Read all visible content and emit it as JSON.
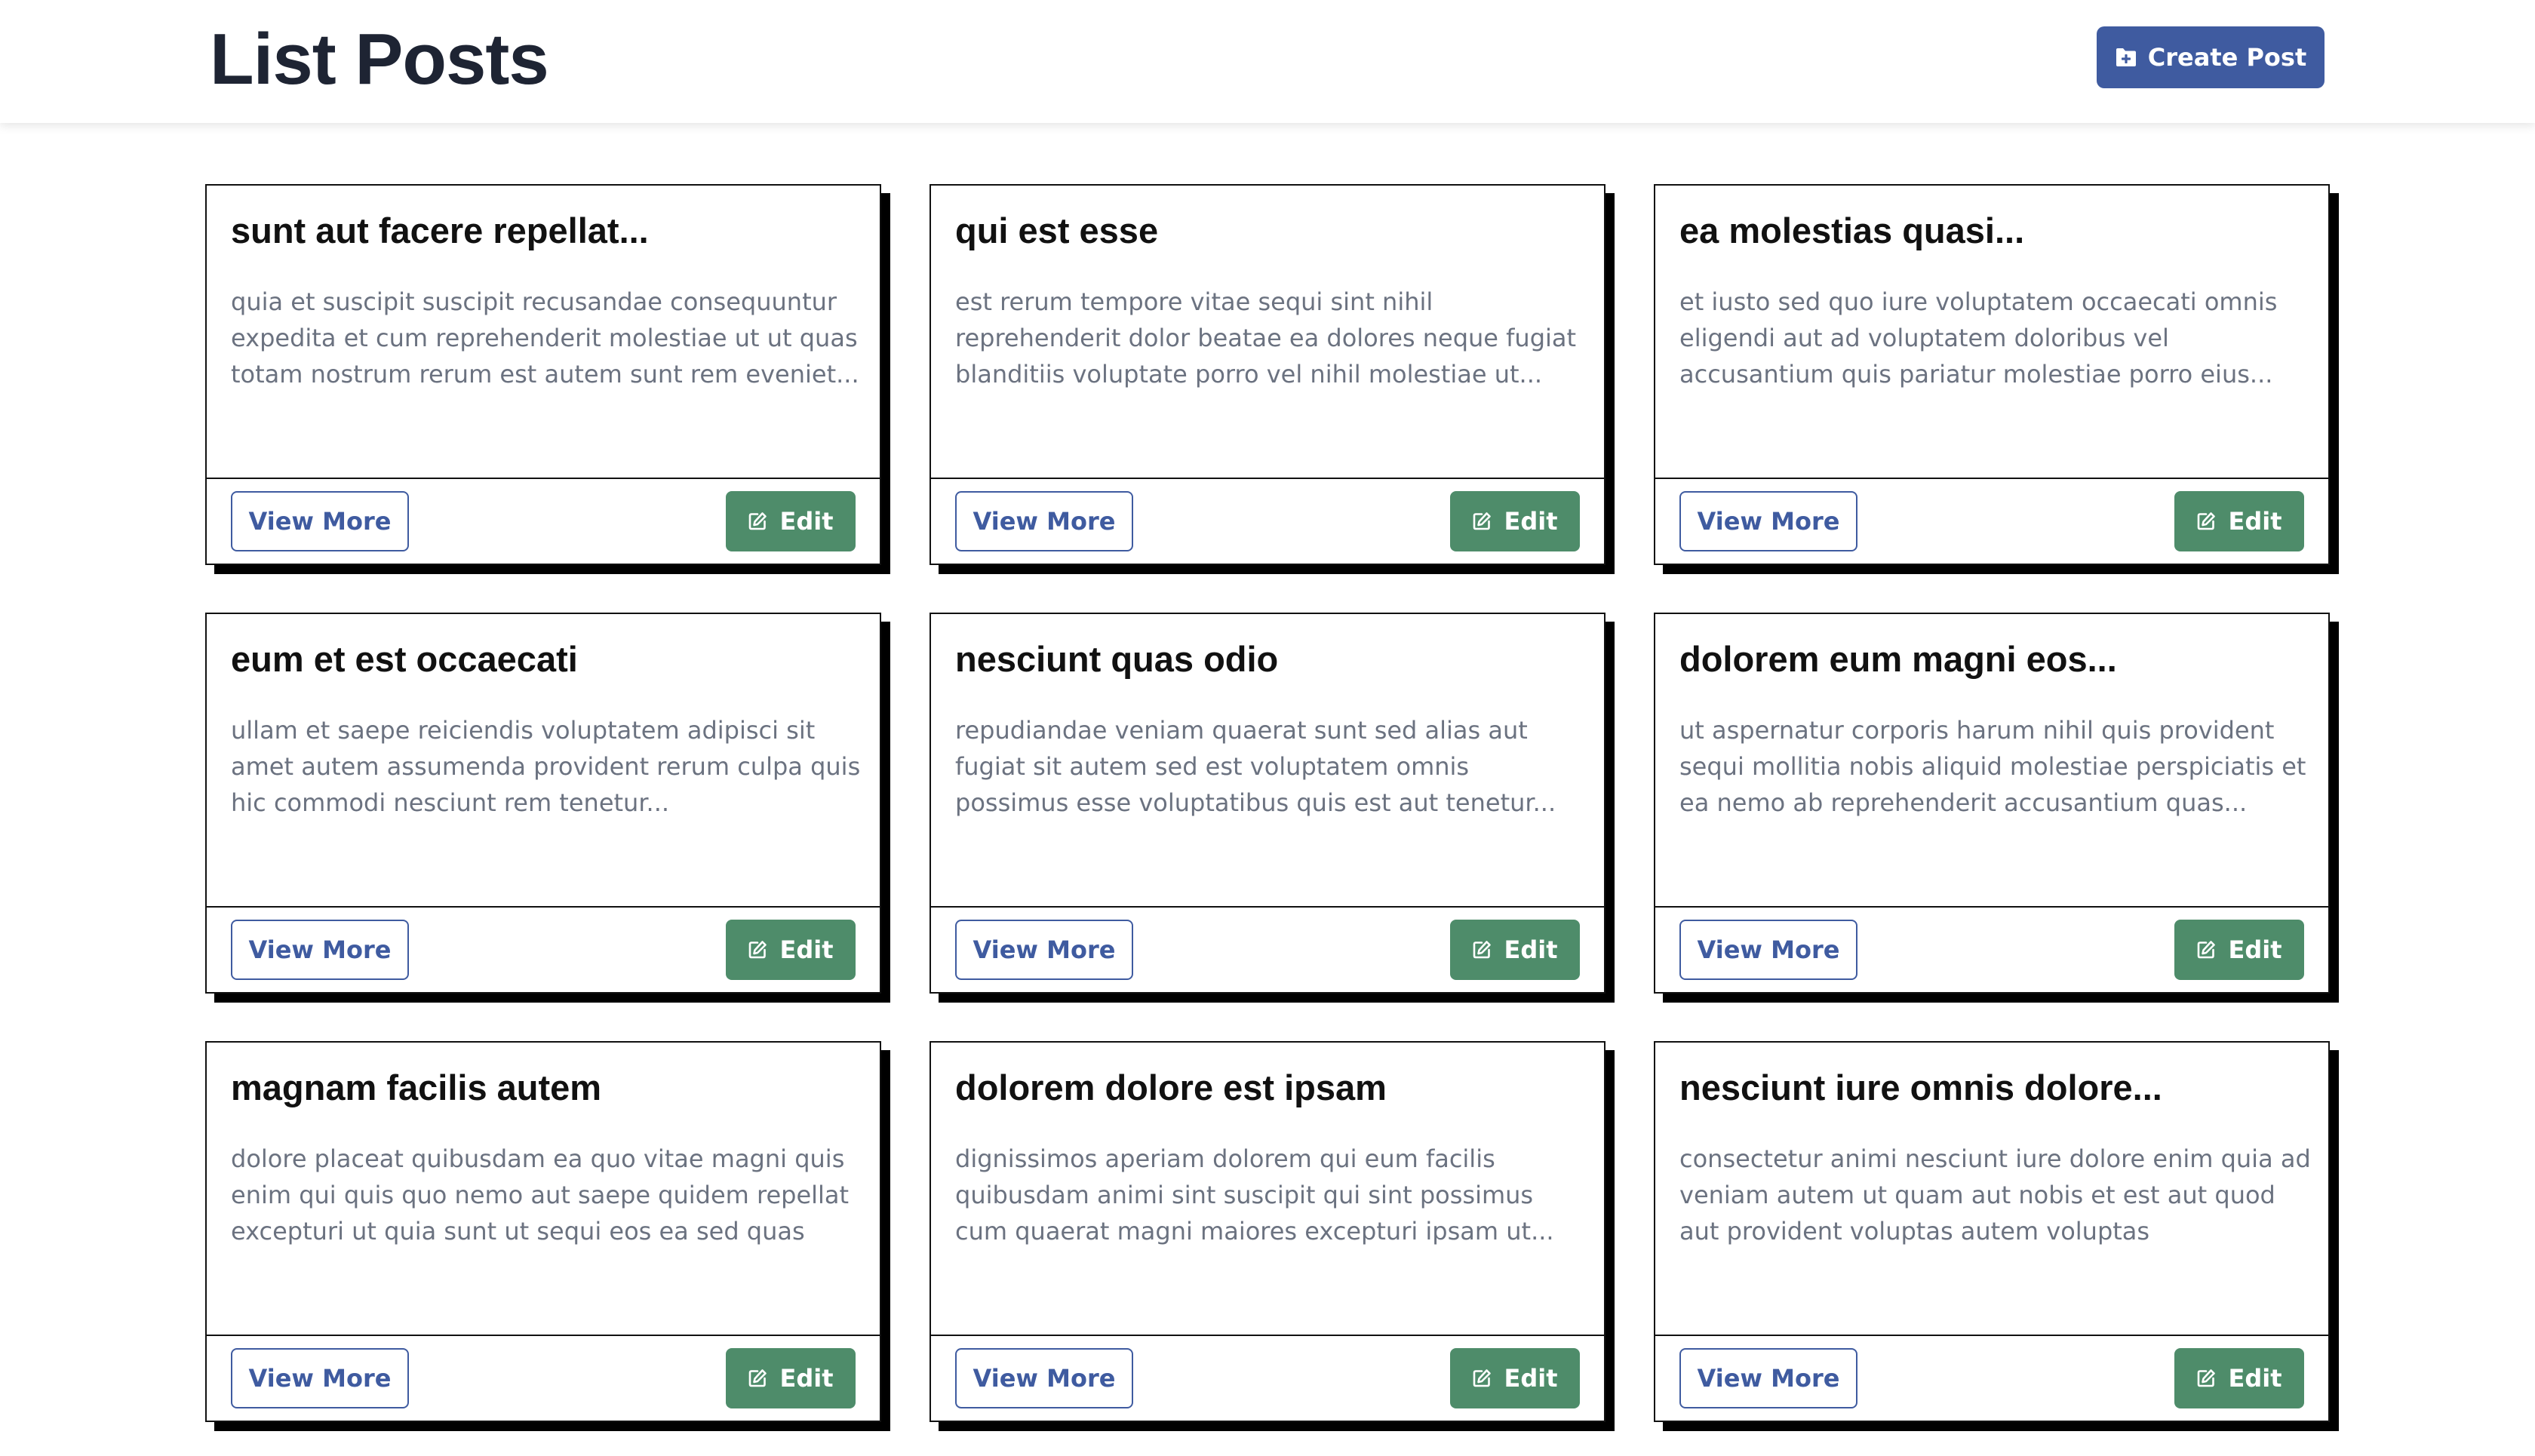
{
  "header": {
    "title": "List Posts",
    "create_button": {
      "label": "Create Post",
      "icon": "folder-plus-icon"
    }
  },
  "colors": {
    "primary": "#3f5ba0",
    "success": "#4e8c6a",
    "title_text": "#1e2433",
    "body_text": "#6b7280"
  },
  "posts": [
    {
      "title": "sunt aut facere repellat...",
      "body": "quia et suscipit suscipit recusandae consequuntur expedita et cum reprehenderit molestiae ut ut quas totam nostrum rerum est autem sunt rem eveniet...",
      "view_label": "View More",
      "edit_label": "Edit"
    },
    {
      "title": "qui est esse",
      "body": "est rerum tempore vitae sequi sint nihil reprehenderit dolor beatae ea dolores neque fugiat blanditiis voluptate porro vel nihil molestiae ut...",
      "view_label": "View More",
      "edit_label": "Edit"
    },
    {
      "title": "ea molestias quasi...",
      "body": "et iusto sed quo iure voluptatem occaecati omnis eligendi aut ad voluptatem doloribus vel accusantium quis pariatur molestiae porro eius...",
      "view_label": "View More",
      "edit_label": "Edit"
    },
    {
      "title": "eum et est occaecati",
      "body": "ullam et saepe reiciendis voluptatem adipisci sit amet autem assumenda provident rerum culpa quis hic commodi nesciunt rem tenetur...",
      "view_label": "View More",
      "edit_label": "Edit"
    },
    {
      "title": "nesciunt quas odio",
      "body": "repudiandae veniam quaerat sunt sed alias aut fugiat sit autem sed est voluptatem omnis possimus esse voluptatibus quis est aut tenetur...",
      "view_label": "View More",
      "edit_label": "Edit"
    },
    {
      "title": "dolorem eum magni eos...",
      "body": "ut aspernatur corporis harum nihil quis provident sequi mollitia nobis aliquid molestiae perspiciatis et ea nemo ab reprehenderit accusantium quas...",
      "view_label": "View More",
      "edit_label": "Edit"
    },
    {
      "title": "magnam facilis autem",
      "body": "dolore placeat quibusdam ea quo vitae magni quis enim qui quis quo nemo aut saepe quidem repellat excepturi ut quia sunt ut sequi eos ea sed quas",
      "view_label": "View More",
      "edit_label": "Edit"
    },
    {
      "title": "dolorem dolore est ipsam",
      "body": "dignissimos aperiam dolorem qui eum facilis quibusdam animi sint suscipit qui sint possimus cum quaerat magni maiores excepturi ipsam ut...",
      "view_label": "View More",
      "edit_label": "Edit"
    },
    {
      "title": "nesciunt iure omnis dolore...",
      "body": "consectetur animi nesciunt iure dolore enim quia ad veniam autem ut quam aut nobis et est aut quod aut provident voluptas autem voluptas",
      "view_label": "View More",
      "edit_label": "Edit"
    }
  ]
}
